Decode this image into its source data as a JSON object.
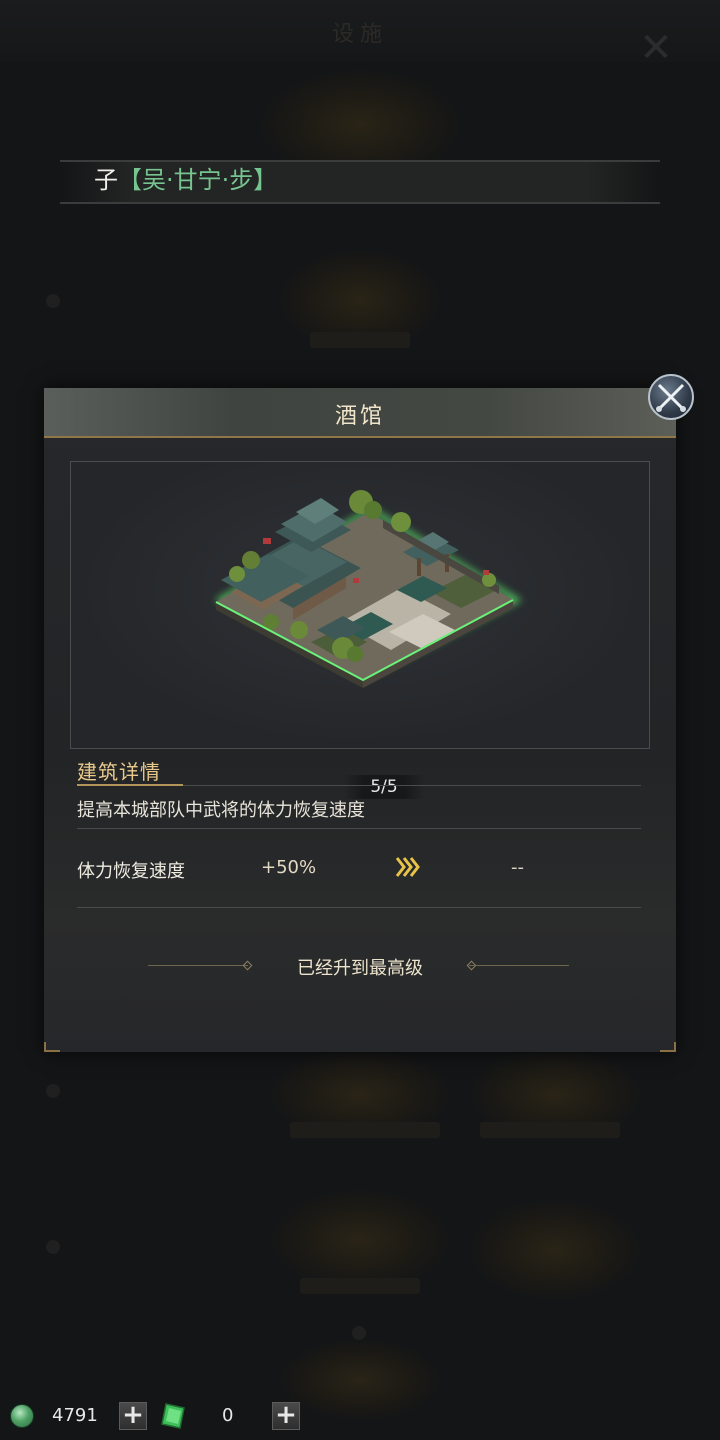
{
  "background": {
    "title": "设施",
    "notice_prefix": "子",
    "notice_highlight": "【吴·甘宁·步】"
  },
  "modal": {
    "title": "酒馆",
    "level": "5/5",
    "section_title": "建筑详情",
    "description": "提高本城部队中武将的体力恢复速度",
    "stat": {
      "name": "体力恢复速度",
      "current": "+50%",
      "next": "--"
    },
    "max_level_text": "已经升到最高级"
  },
  "resources": {
    "jade_value": "4791",
    "ticket_value": "0"
  },
  "colors": {
    "accent_gold": "#e9c98c",
    "notice_green": "#76c48f",
    "building_glow": "#5be06a"
  }
}
